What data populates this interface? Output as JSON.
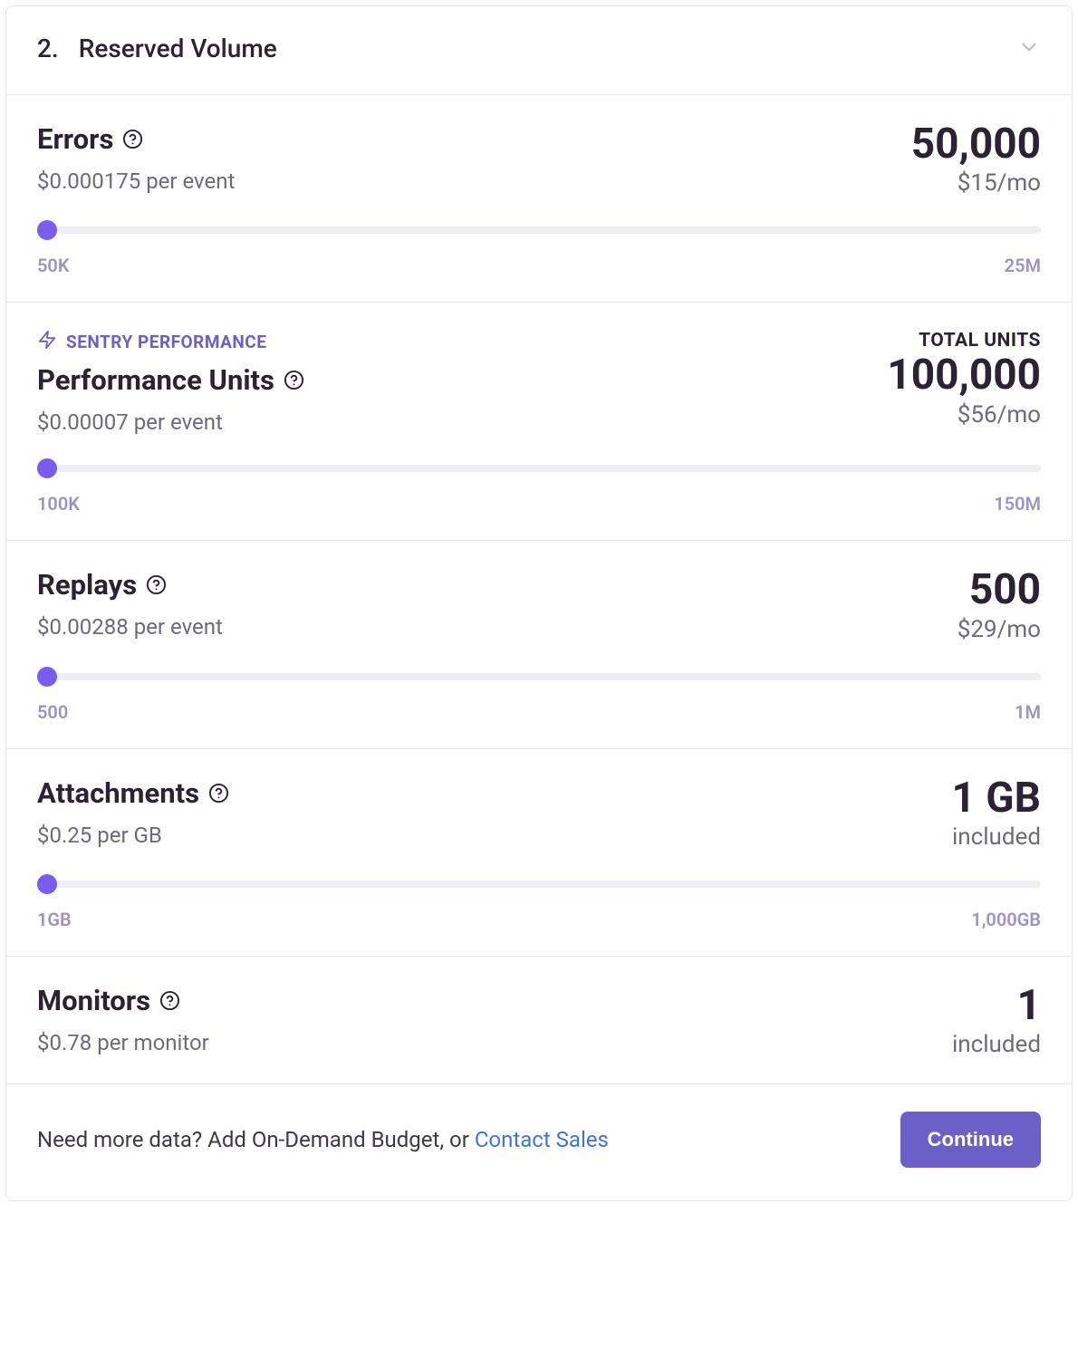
{
  "header": {
    "step_number": "2.",
    "title": "Reserved Volume"
  },
  "panels": [
    {
      "overline": null,
      "overline_right": null,
      "title": "Errors",
      "pricing": "$0.000175 per event",
      "value": "50,000",
      "permonth": "$15/mo",
      "min": "50K",
      "max": "25M"
    },
    {
      "overline": "SENTRY PERFORMANCE",
      "overline_right": "TOTAL UNITS",
      "title": "Performance Units",
      "pricing": "$0.00007 per event",
      "value": "100,000",
      "permonth": "$56/mo",
      "min": "100K",
      "max": "150M"
    },
    {
      "overline": null,
      "overline_right": null,
      "title": "Replays",
      "pricing": "$0.00288 per event",
      "value": "500",
      "permonth": "$29/mo",
      "min": "500",
      "max": "1M"
    },
    {
      "overline": null,
      "overline_right": null,
      "title": "Attachments",
      "pricing": "$0.25 per GB",
      "value": "1 GB",
      "permonth": "included",
      "min": "1GB",
      "max": "1,000GB"
    },
    {
      "overline": null,
      "overline_right": null,
      "title": "Monitors",
      "pricing": "$0.78 per monitor",
      "value": "1",
      "permonth": "included",
      "min": null,
      "max": null
    }
  ],
  "footer": {
    "text_prefix": "Need more data? Add On-Demand Budget, or ",
    "link_text": "Contact Sales",
    "button": "Continue"
  }
}
